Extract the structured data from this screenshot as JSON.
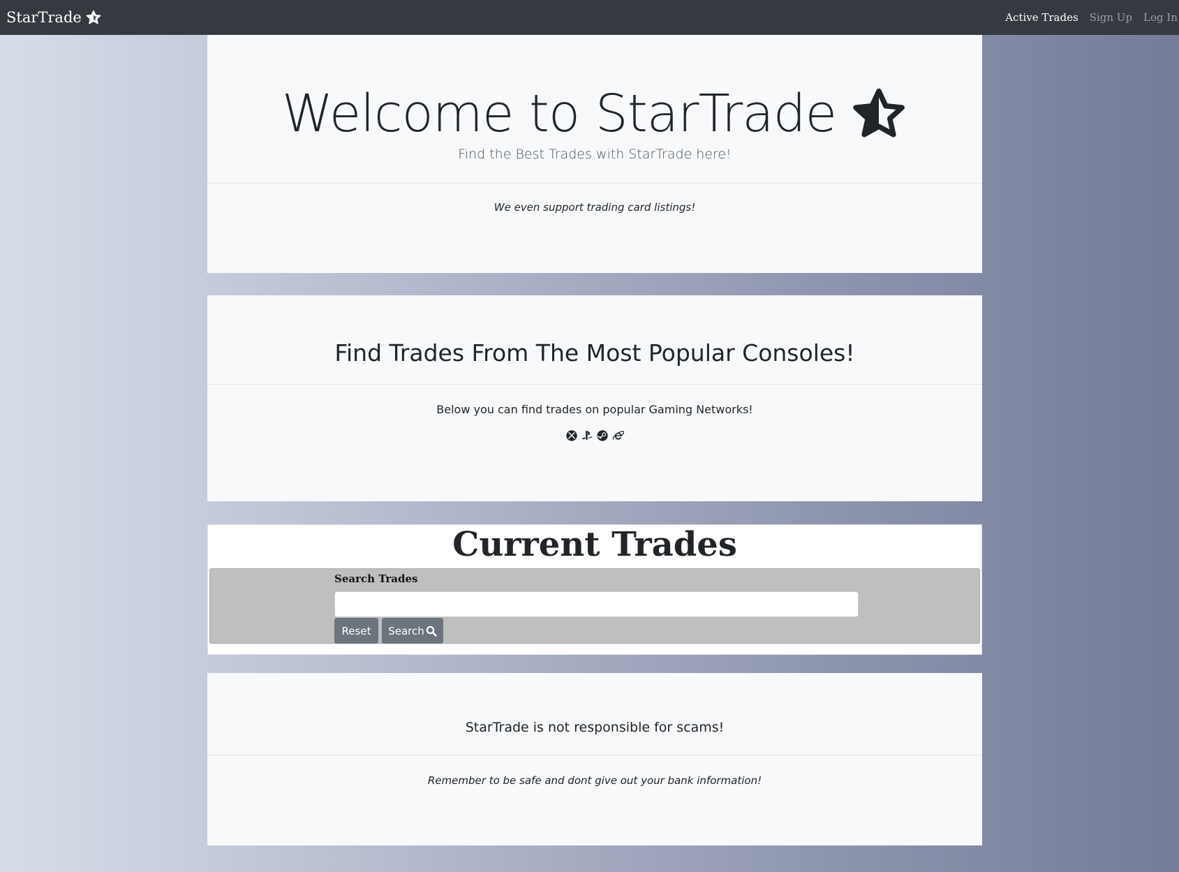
{
  "nav": {
    "brand": "StarTrade",
    "links": [
      "Active Trades",
      "Sign Up",
      "Log In"
    ]
  },
  "hero": {
    "title": "Welcome to StarTrade",
    "subtitle": "Find the Best Trades with StarTrade here!",
    "note": "We even support trading card listings!"
  },
  "consoles": {
    "title": "Find Trades From The Most Popular Consoles!",
    "text": "Below you can find trades on popular Gaming Networks!",
    "icons": [
      "xbox-icon",
      "playstation-icon",
      "steam-icon",
      "internet-explorer-icon"
    ]
  },
  "trades": {
    "title": "Current Trades",
    "search_label": "Search Trades",
    "search_value": "",
    "reset_label": "Reset",
    "search_button_label": "Search"
  },
  "footer": {
    "warning_title": "StarTrade is not responsible for scams!",
    "warning_text": "Remember to be safe and dont give out your bank information!"
  },
  "colors": {
    "navbar": "#343a40",
    "card": "#f8f9fa",
    "button": "#6c757d",
    "search_panel": "#bfbfbf"
  }
}
